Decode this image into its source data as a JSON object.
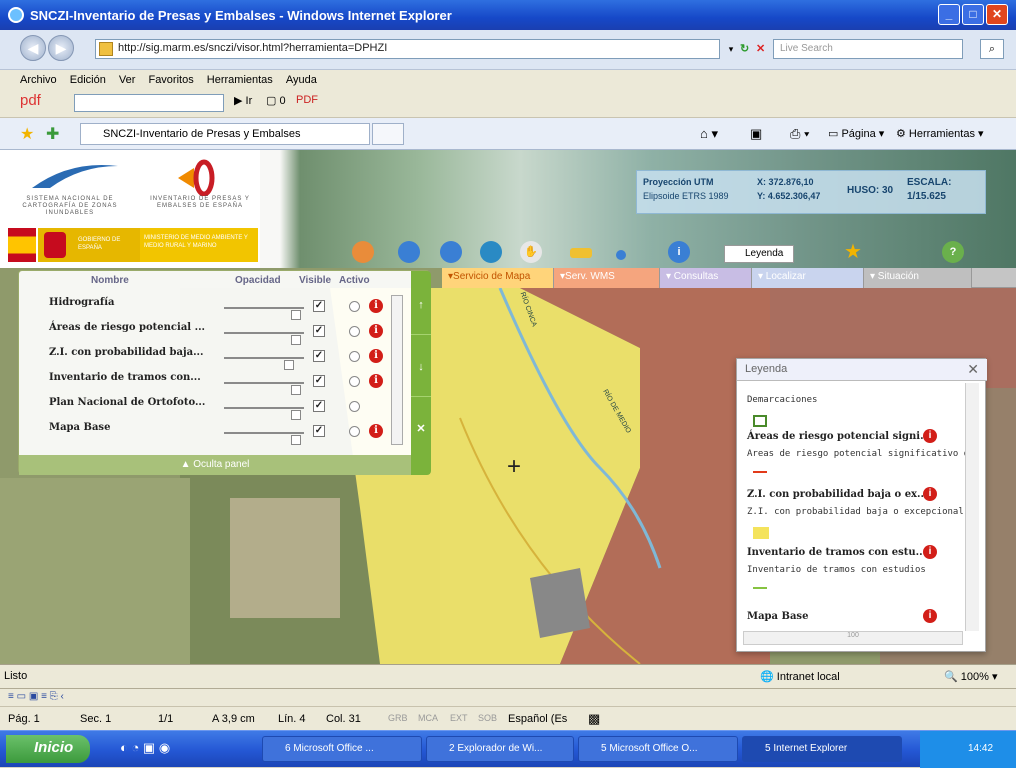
{
  "window": {
    "title": "SNCZI-Inventario de Presas y Embalses - Windows Internet Explorer"
  },
  "address": {
    "url": "http://sig.marm.es/snczi/visor.html?herramienta=DPHZI",
    "search_placeholder": "Live Search"
  },
  "menu": [
    "Archivo",
    "Edición",
    "Ver",
    "Favoritos",
    "Herramientas",
    "Ayuda"
  ],
  "pdfbar": {
    "label": "pdf",
    "go": "Ir",
    "count": "0",
    "pdf": "PDF"
  },
  "tab": {
    "label": "SNCZI-Inventario de Presas y Embalses"
  },
  "commandbar": {
    "page": "Página",
    "tools": "Herramientas"
  },
  "logos": {
    "org1": "SISTEMA NACIONAL DE CARTOGRAFÍA DE ZONAS INUNDABLES",
    "org2": "INVENTARIO DE PRESAS Y EMBALSES DE ESPAÑA",
    "gov": "GOBIERNO DE ESPAÑA",
    "ministry": "MINISTERIO DE MEDIO AMBIENTE Y MEDIO RURAL Y MARINO"
  },
  "coords": {
    "projection": "Proyección UTM",
    "ellipsoid": "Elipsoide ETRS 1989",
    "x": "X: 372.876,10",
    "y": "Y: 4.652.306,47",
    "huso": "HUSO: 30",
    "scale_label": "ESCALA:",
    "scale_value": "1/15.625"
  },
  "legend_button": "Leyenda",
  "map_tabs": [
    "▾Servicio de Mapa",
    "▾Serv. WMS",
    "▾ Consultas",
    "▾ Localizar",
    "▾ Situación"
  ],
  "layer_panel": {
    "headers": {
      "name": "Nombre",
      "opacity": "Opacidad",
      "visible": "Visible",
      "active": "Activo"
    },
    "layers": [
      {
        "name": "Hidrografía",
        "opacity": 0.95,
        "visible": true,
        "info": true
      },
      {
        "name": "Áreas de riesgo potencial ...",
        "opacity": 0.95,
        "visible": true,
        "info": true
      },
      {
        "name": "Z.I. con probabilidad baja...",
        "opacity": 0.85,
        "visible": true,
        "info": true
      },
      {
        "name": "Inventario de tramos con...",
        "opacity": 0.95,
        "visible": true,
        "info": true
      },
      {
        "name": "Plan Nacional de Ortofoto...",
        "opacity": 0.95,
        "visible": true,
        "info": false
      },
      {
        "name": "Mapa Base",
        "opacity": 0.95,
        "visible": true,
        "info": true
      }
    ],
    "hide": "▲ Oculta panel"
  },
  "map_labels": {
    "river1": "RÍO CINCA",
    "river2": "RÍO DE MEDIO"
  },
  "legend_window": {
    "title": "Leyenda",
    "entries": [
      {
        "title": "",
        "text": "Demarcaciones",
        "color": "#4a8a2a"
      },
      {
        "title": "Áreas de riesgo potencial signi...",
        "text": "Áreas de riesgo potencial significativo de i",
        "color": "#e23a1a"
      },
      {
        "title": "Z.I. con probabilidad baja o ex...",
        "text": "Z.I. con probabilidad baja o excepcional (T",
        "color": "#f4e35c"
      },
      {
        "title": "Inventario de tramos con estu...",
        "text": "Inventario de tramos con estudios",
        "color": "#86c341"
      },
      {
        "title": "Mapa Base",
        "text": "",
        "color": ""
      }
    ],
    "hscroll_label": "100"
  },
  "status": {
    "text": "Listo",
    "zone": "Intranet local",
    "zoom": "100%"
  },
  "word": {
    "page": "Pág. 1",
    "sec": "Sec. 1",
    "pages": "1/1",
    "at": "A 3,9 cm",
    "line": "Lín. 4",
    "col": "Col. 31",
    "grb": "GRB",
    "mca": "MCA",
    "ext": "EXT",
    "sob": "SOB",
    "lang": "Español (Es"
  },
  "taskbar": {
    "start": "Inicio",
    "tasks": [
      "6 Microsoft Office ...",
      "2 Explorador de Wi...",
      "5 Microsoft Office O...",
      "5 Internet Explorer"
    ],
    "time": "14:42"
  }
}
